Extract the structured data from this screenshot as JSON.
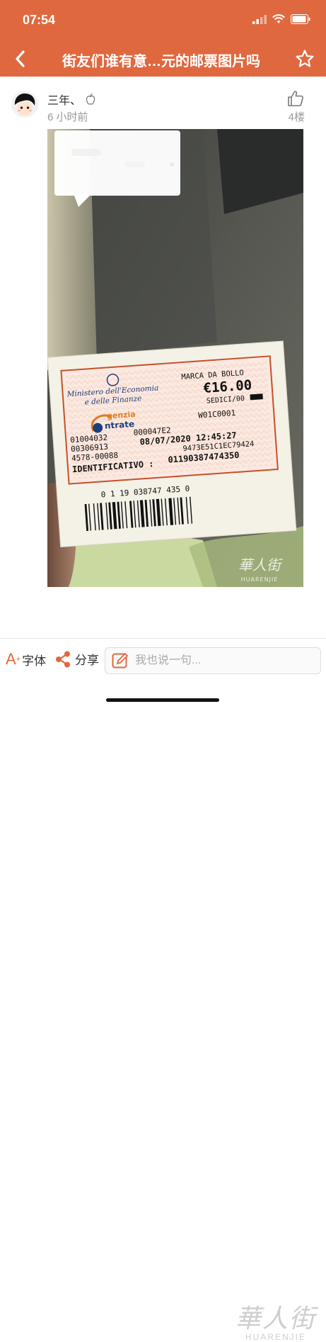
{
  "status_bar": {
    "time": "07:54"
  },
  "nav": {
    "title": "街友们谁有意…元的邮票图片吗"
  },
  "post": {
    "username": "三年、",
    "time": "6 小时前",
    "floor": "4楼"
  },
  "photo": {
    "stamp": {
      "ministry_line1": "Ministero dell'Economia",
      "ministry_line2": "e delle Finanze",
      "marca": "MARCA DA BOLLO",
      "amount": "€16.00",
      "amount_words": "SEDICI/00",
      "agency_line1": "genzia",
      "agency_line2": "ntrate",
      "code1": "01004032",
      "code2": "00306913",
      "code3": "4578-00088",
      "code4": "000047E2",
      "date": "08/07/2020 12:45:27",
      "code5": "W01C0001",
      "hash": "9473E51C1EC79424",
      "identificativo_label": "IDENTIFICATIVO :",
      "identificativo": "01190387474350",
      "barcode_number": "0 1 19 038747 435 0"
    },
    "watermark_cn": "華人街",
    "watermark_en": "HUARENJIE"
  },
  "bottom_bar": {
    "font_label": "字体",
    "share_label": "分享",
    "comment_placeholder": "我也说一句..."
  },
  "watermark": {
    "cn": "華人街",
    "en": "HUARENJIE"
  },
  "colors": {
    "brand": "#e0683f",
    "stamp_red": "#c8502a"
  }
}
